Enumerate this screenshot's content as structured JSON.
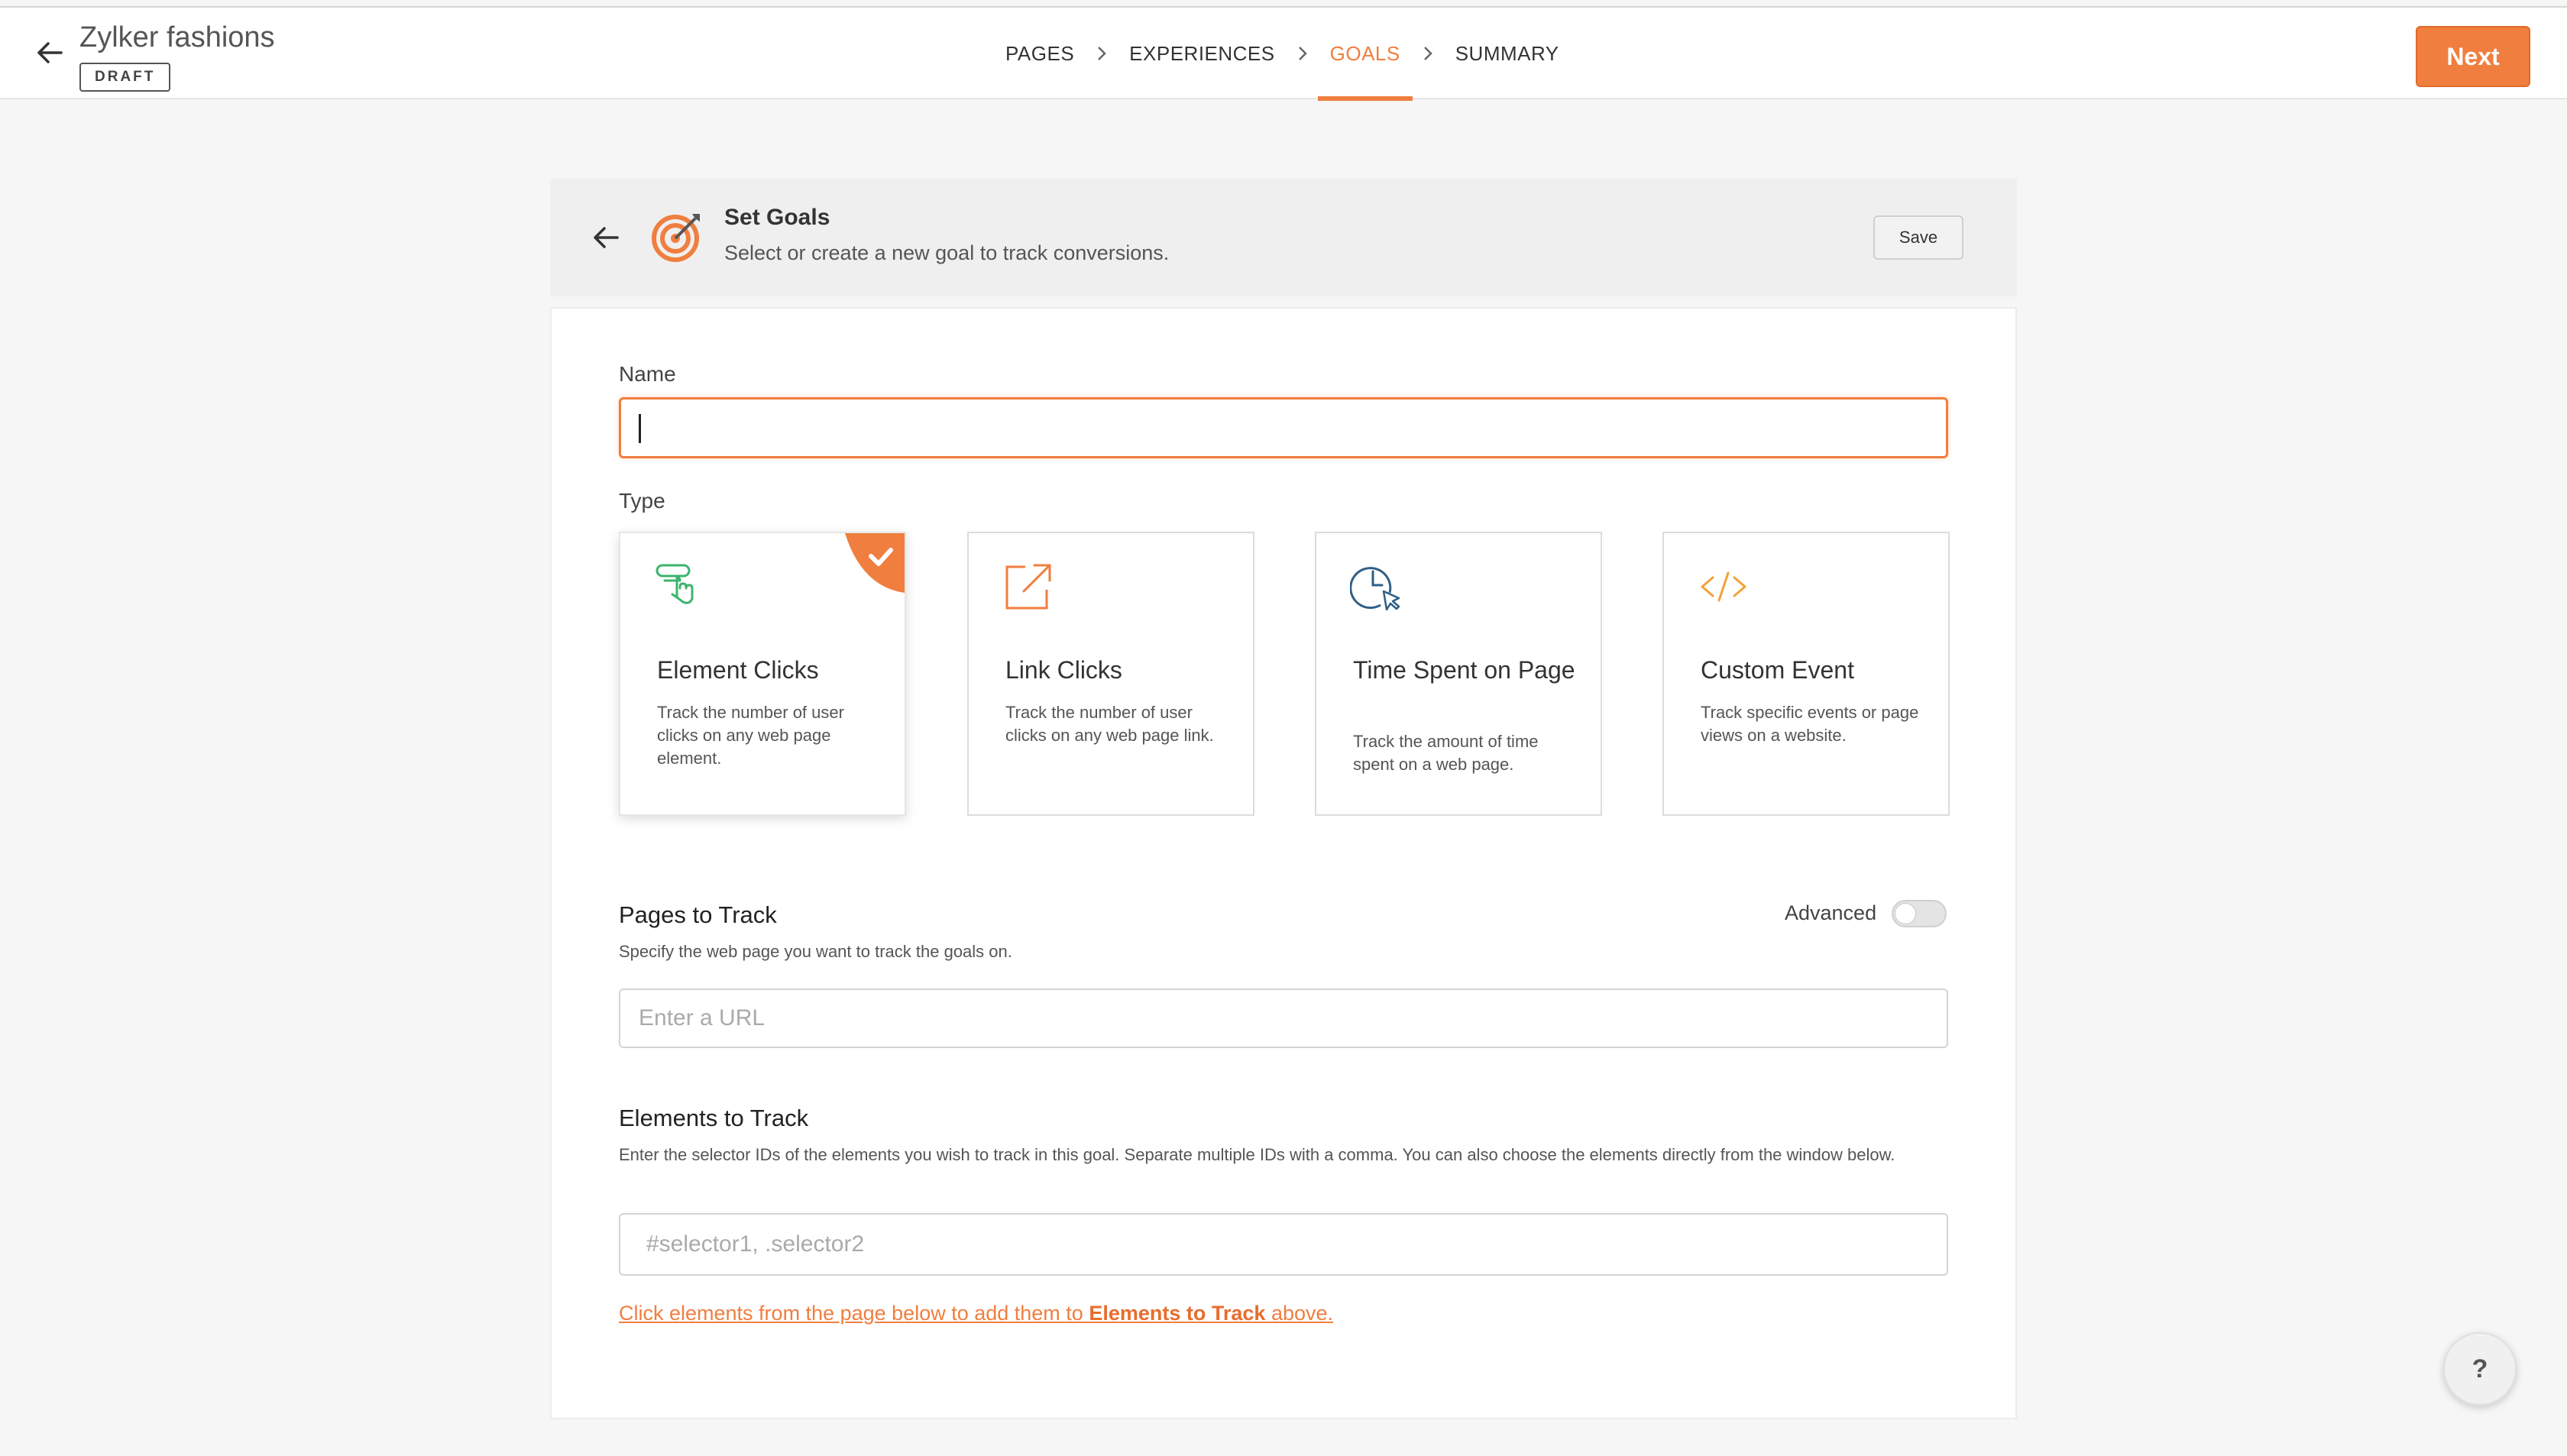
{
  "header": {
    "title": "Zylker fashions",
    "status_badge": "DRAFT",
    "next_label": "Next",
    "steps": [
      {
        "label": "PAGES",
        "active": false
      },
      {
        "label": "EXPERIENCES",
        "active": false
      },
      {
        "label": "GOALS",
        "active": true
      },
      {
        "label": "SUMMARY",
        "active": false
      }
    ]
  },
  "goals_panel": {
    "title": "Set Goals",
    "subtitle": "Select or create a new goal to track conversions.",
    "save_label": "Save"
  },
  "form": {
    "name_label": "Name",
    "name_value": "",
    "type_label": "Type",
    "types": [
      {
        "title": "Element Clicks",
        "description": "Track the number of user clicks on any web page element.",
        "icon": "element-click-icon",
        "selected": true
      },
      {
        "title": "Link Clicks",
        "description": "Track the number of user clicks on any web page link.",
        "icon": "external-link-icon",
        "selected": false
      },
      {
        "title": "Time Spent on Page",
        "description": "Track the amount of time spent on a web page.",
        "icon": "clock-cursor-icon",
        "selected": false
      },
      {
        "title": "Custom Event",
        "description": "Track specific events or page views on a website.",
        "icon": "code-icon",
        "selected": false
      }
    ],
    "pages": {
      "title": "Pages to Track",
      "description": "Specify the web page you want to track the goals on.",
      "advanced_label": "Advanced",
      "advanced_on": false,
      "url_placeholder": "Enter a URL",
      "url_value": ""
    },
    "elements": {
      "title": "Elements to Track",
      "description": "Enter the selector IDs of the elements you wish to track in this goal. Separate multiple IDs with a comma. You can also choose the elements directly from the window below.",
      "selector_placeholder": "#selector1, .selector2",
      "selector_value": "",
      "hint_prefix": "Click elements from the page below to add them to ",
      "hint_bold": "Elements to Track",
      "hint_suffix": " above."
    }
  },
  "help_label": "?",
  "colors": {
    "accent": "#f07e3f",
    "element_icon": "#3cb46e",
    "time_icon": "#2f5f86",
    "code_icon": "#f2a23a"
  }
}
